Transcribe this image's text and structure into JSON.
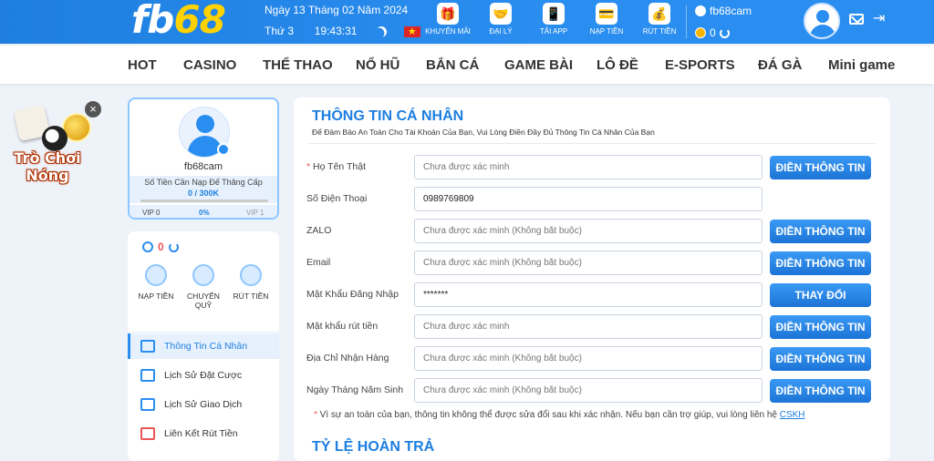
{
  "header": {
    "logo_main": "fb",
    "logo_accent": "68",
    "date": "Ngày 13 Tháng 02 Năm 2024",
    "weekday": "Thứ 3",
    "time": "19:43:31",
    "actions": [
      {
        "label": "KHUYẾN MÃI",
        "icon": "gift-icon"
      },
      {
        "label": "ĐẠI LÝ",
        "icon": "handshake-icon"
      },
      {
        "label": "TẢI APP",
        "icon": "phone-download-icon"
      },
      {
        "label": "NẠP TIỀN",
        "icon": "wallet-icon"
      },
      {
        "label": "RÚT TIỀN",
        "icon": "money-bag-icon"
      }
    ],
    "username": "fb68cam",
    "balance": "0"
  },
  "nav": {
    "items": [
      "HOT",
      "CASINO",
      "THỂ THAO",
      "NỔ HŨ",
      "BẮN CÁ",
      "GAME BÀI",
      "LÔ ĐỀ",
      "E-SPORTS",
      "ĐÁ GÀ",
      "Mini game"
    ]
  },
  "promo": {
    "line1": "Trò Chơi",
    "line2": "Nóng"
  },
  "profile": {
    "name": "fb68cam",
    "hint": "Số Tiền Cần Nạp Để Thăng Cấp",
    "progress_text": "0 / 300K",
    "vip_current": "VIP 0",
    "vip_percent": "0%",
    "vip_next": "VIP 1",
    "progress_fraction": 0
  },
  "wallet": {
    "balance": "0",
    "actions": [
      {
        "label": "NẠP TIỀN"
      },
      {
        "label": "CHUYỂN QUỸ"
      },
      {
        "label": "RÚT TIỀN"
      }
    ],
    "menu": [
      {
        "label": "Thông Tin Cá Nhân",
        "active": true
      },
      {
        "label": "Lịch Sử Đặt Cược",
        "active": false
      },
      {
        "label": "Lịch Sử Giao Dịch",
        "active": false
      },
      {
        "label": "Liên Kết Rút Tiền",
        "active": false
      }
    ]
  },
  "main": {
    "title": "THÔNG TIN CÁ NHÂN",
    "subtitle": "Để Đảm Bảo An Toàn Cho Tài Khoản Của Bạn, Vui Lòng Điền Đầy Đủ Thông Tin Cá Nhân Của Bạn",
    "fields": [
      {
        "label": "Họ Tên Thật",
        "required": true,
        "value": "",
        "placeholder": "Chưa được xác minh",
        "button": "ĐIỀN THÔNG TIN"
      },
      {
        "label": "Số Điện Thoại",
        "required": false,
        "value": "0989769809",
        "placeholder": "",
        "button": ""
      },
      {
        "label": "ZALO",
        "required": false,
        "value": "",
        "placeholder": "Chưa được xác minh (Không bắt buộc)",
        "button": "ĐIỀN THÔNG TIN"
      },
      {
        "label": "Email",
        "required": false,
        "value": "",
        "placeholder": "Chưa được xác minh (Không bắt buộc)",
        "button": "ĐIỀN THÔNG TIN"
      },
      {
        "label": "Mật Khẩu Đăng Nhập",
        "required": false,
        "value": "*******",
        "placeholder": "",
        "button": "THAY ĐỔI"
      },
      {
        "label": "Mật khẩu rút tiền",
        "required": false,
        "value": "",
        "placeholder": "Chưa được xác minh",
        "button": "ĐIỀN THÔNG TIN"
      },
      {
        "label": "Địa Chỉ Nhận Hàng",
        "required": false,
        "value": "",
        "placeholder": "Chưa được xác minh (Không bắt buộc)",
        "button": "ĐIỀN THÔNG TIN"
      },
      {
        "label": "Ngày Tháng Năm Sinh",
        "required": false,
        "value": "",
        "placeholder": "Chưa được xác minh (Không bắt buộc)",
        "button": "ĐIỀN THÔNG TIN"
      }
    ],
    "notice": "Vì sự an toàn của bạn, thông tin không thể được sửa đổi sau khi xác nhận. Nếu bạn cần trợ giúp, vui lòng liên hệ",
    "notice_link": "CSKH",
    "section2_title": "TỶ LỆ HOÀN TRẢ"
  }
}
